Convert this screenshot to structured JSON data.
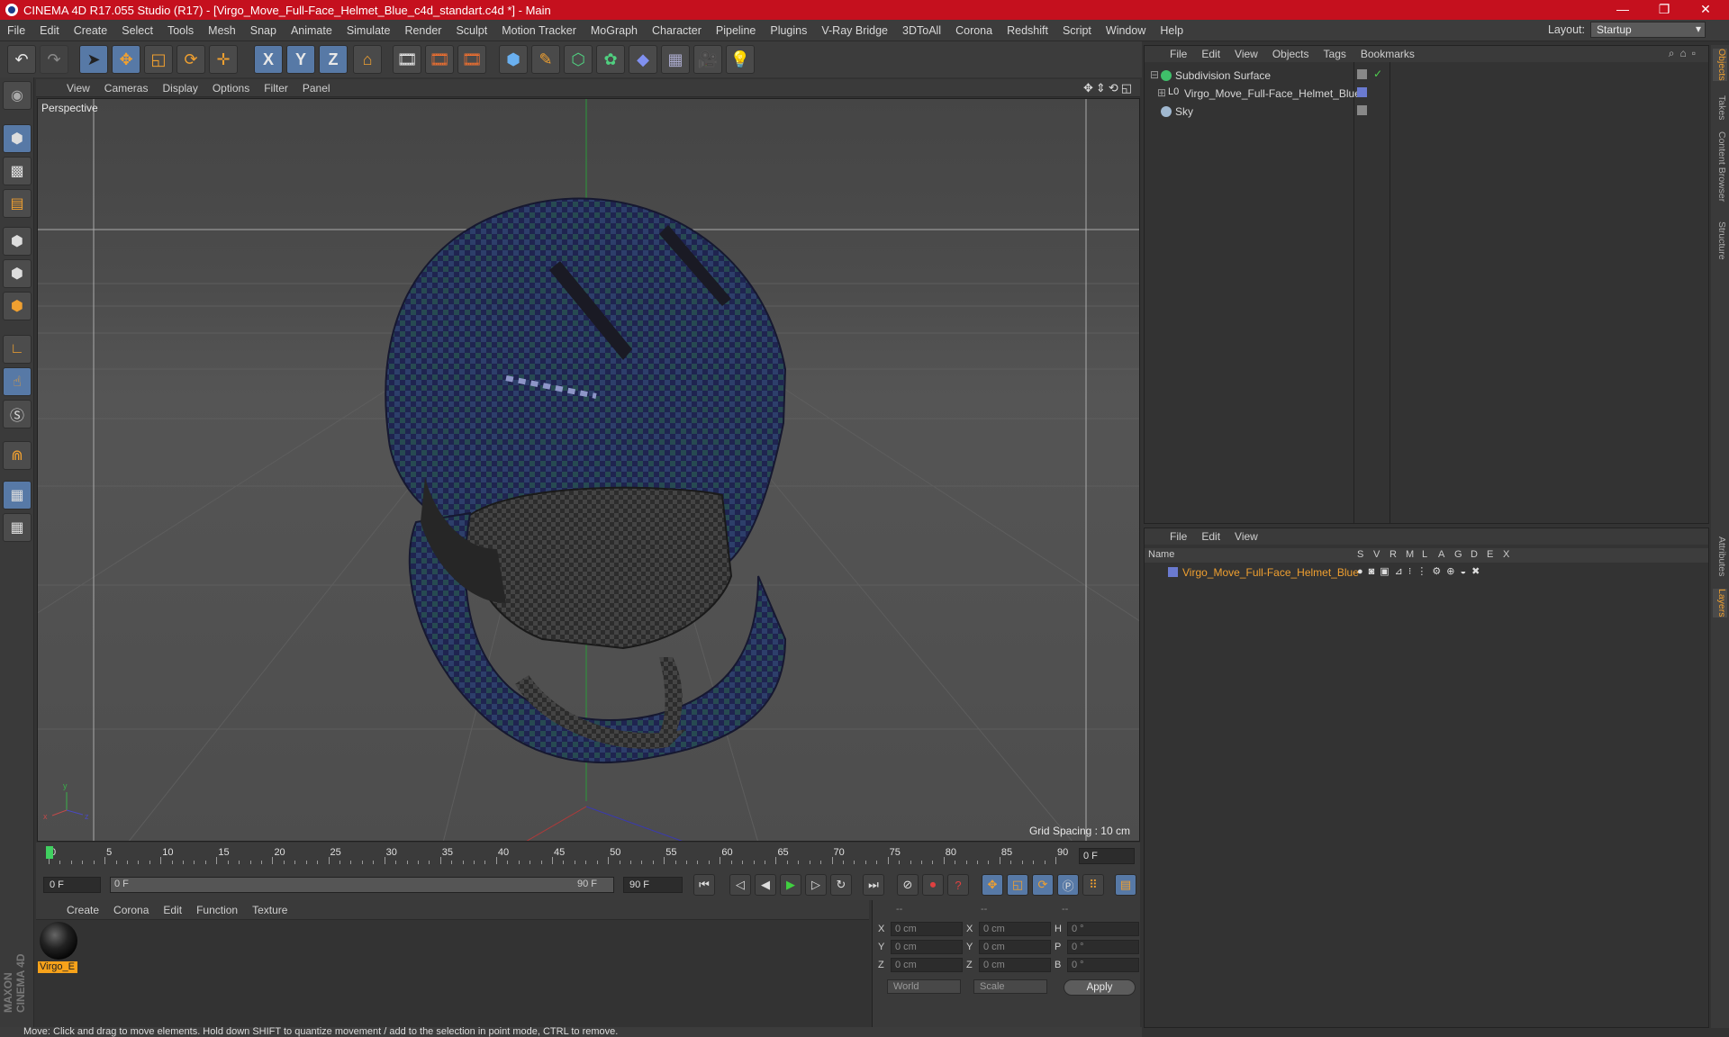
{
  "window": {
    "title": "CINEMA 4D R17.055 Studio (R17) - [Virgo_Move_Full-Face_Helmet_Blue_c4d_standart.c4d *] - Main",
    "controls": [
      "—",
      "❐",
      "✕"
    ]
  },
  "menubar": {
    "items": [
      "File",
      "Edit",
      "Create",
      "Select",
      "Tools",
      "Mesh",
      "Snap",
      "Animate",
      "Simulate",
      "Render",
      "Sculpt",
      "Motion Tracker",
      "MoGraph",
      "Character",
      "Pipeline",
      "Plugins",
      "V-Ray Bridge",
      "3DToAll",
      "Corona",
      "Redshift",
      "Script",
      "Window",
      "Help"
    ],
    "layout_label": "Layout:",
    "layout_value": "Startup"
  },
  "toolbar": {
    "axis": [
      "X",
      "Y",
      "Z"
    ]
  },
  "viewport": {
    "menu": [
      "View",
      "Cameras",
      "Display",
      "Options",
      "Filter",
      "Panel"
    ],
    "label": "Perspective",
    "grid_spacing": "Grid Spacing : 10 cm",
    "icons": "✥⇕⟲◱"
  },
  "timeline": {
    "ticks": [
      "0",
      "5",
      "10",
      "15",
      "20",
      "25",
      "30",
      "35",
      "40",
      "45",
      "50",
      "55",
      "60",
      "65",
      "70",
      "75",
      "80",
      "85",
      "90"
    ],
    "current_frame": "0 F"
  },
  "transport": {
    "start": "0 F",
    "range_start": "0 F",
    "range_end": "90 F",
    "end": "90 F"
  },
  "materials": {
    "menu": [
      "Create",
      "Corona",
      "Edit",
      "Function",
      "Texture"
    ],
    "items": [
      {
        "name": "Virgo_E"
      }
    ]
  },
  "coords": {
    "header": [
      "--",
      "--",
      "--"
    ],
    "rows": [
      {
        "a": "X",
        "v1": "0 cm",
        "b": "X",
        "v2": "0 cm",
        "c": "H",
        "v3": "0 °"
      },
      {
        "a": "Y",
        "v1": "0 cm",
        "b": "Y",
        "v2": "0 cm",
        "c": "P",
        "v3": "0 °"
      },
      {
        "a": "Z",
        "v1": "0 cm",
        "b": "Z",
        "v2": "0 cm",
        "c": "B",
        "v3": "0 °"
      }
    ],
    "mode": "World",
    "size_mode": "Scale",
    "apply": "Apply"
  },
  "objects": {
    "menu": [
      "File",
      "Edit",
      "View",
      "Objects",
      "Tags",
      "Bookmarks"
    ],
    "items": [
      {
        "name": "Subdivision Surface",
        "icon_color": "#3fbf6a"
      },
      {
        "name": "Virgo_Move_Full-Face_Helmet_Blue",
        "icon_color": "#c8c8c8"
      },
      {
        "name": "Sky",
        "icon_color": "#a0b8d0"
      }
    ]
  },
  "layers": {
    "menu": [
      "File",
      "Edit",
      "View"
    ],
    "header": {
      "name": "Name",
      "cols": [
        "S",
        "V",
        "R",
        "M",
        "L",
        "A",
        "G",
        "D",
        "E",
        "X"
      ]
    },
    "items": [
      {
        "name": "Virgo_Move_Full-Face_Helmet_Blue",
        "color": "#f0a030"
      }
    ]
  },
  "right_tabs": [
    "Objects",
    "Takes",
    "Content Browser",
    "Structure",
    "Attributes",
    "Layers"
  ],
  "status": "Move: Click and drag to move elements. Hold down SHIFT to quantize movement / add to the selection in point mode, CTRL to remove.",
  "maxon": "MAXON CINEMA 4D"
}
